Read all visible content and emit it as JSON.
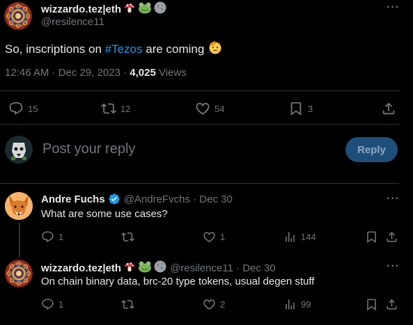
{
  "tweet": {
    "author_name": "wizzardo.tez|eth",
    "author_handle": "@resilence11",
    "text_before": "So, inscriptions on ",
    "hashtag": "#Tezos",
    "text_after": " are coming",
    "time": "12:46 AM · Dec 29, 2023 · ",
    "views_count": "4,025",
    "views_label": " Views",
    "replies": "15",
    "reposts": "12",
    "likes": "54",
    "bookmarks": "3",
    "more": "···"
  },
  "composer": {
    "placeholder": "Post your reply",
    "button": "Reply"
  },
  "replies": [
    {
      "author_name": "Andre Fuchs",
      "author_handle": "@AndreFvchs",
      "date": " · Dec 30",
      "text": "What are some use cases?",
      "replies": "1",
      "reposts": "",
      "likes": "1",
      "views": "144",
      "more": "···"
    },
    {
      "author_name": "wizzardo.tez|eth",
      "author_handle": "@resilence11",
      "date": " · Dec 30",
      "text": "On chain binary data, brc-20 type tokens, usual degen stuff",
      "replies": "1",
      "reposts": "",
      "likes": "2",
      "views": "99",
      "more": "···"
    }
  ],
  "colors": {
    "background": "#000000",
    "text": "#e7e9ea",
    "muted": "#71767b",
    "accent": "#1d9bf0",
    "verified": "#1d9bf0",
    "reply_button_bg": "#1d4f7a"
  },
  "icons": [
    "mushroom-icon",
    "frog-icon",
    "moon-icon",
    "saluting-face-icon",
    "verified-badge-icon",
    "reply-icon",
    "repost-icon",
    "like-icon",
    "bookmark-icon",
    "share-icon",
    "views-icon",
    "more-icon"
  ]
}
